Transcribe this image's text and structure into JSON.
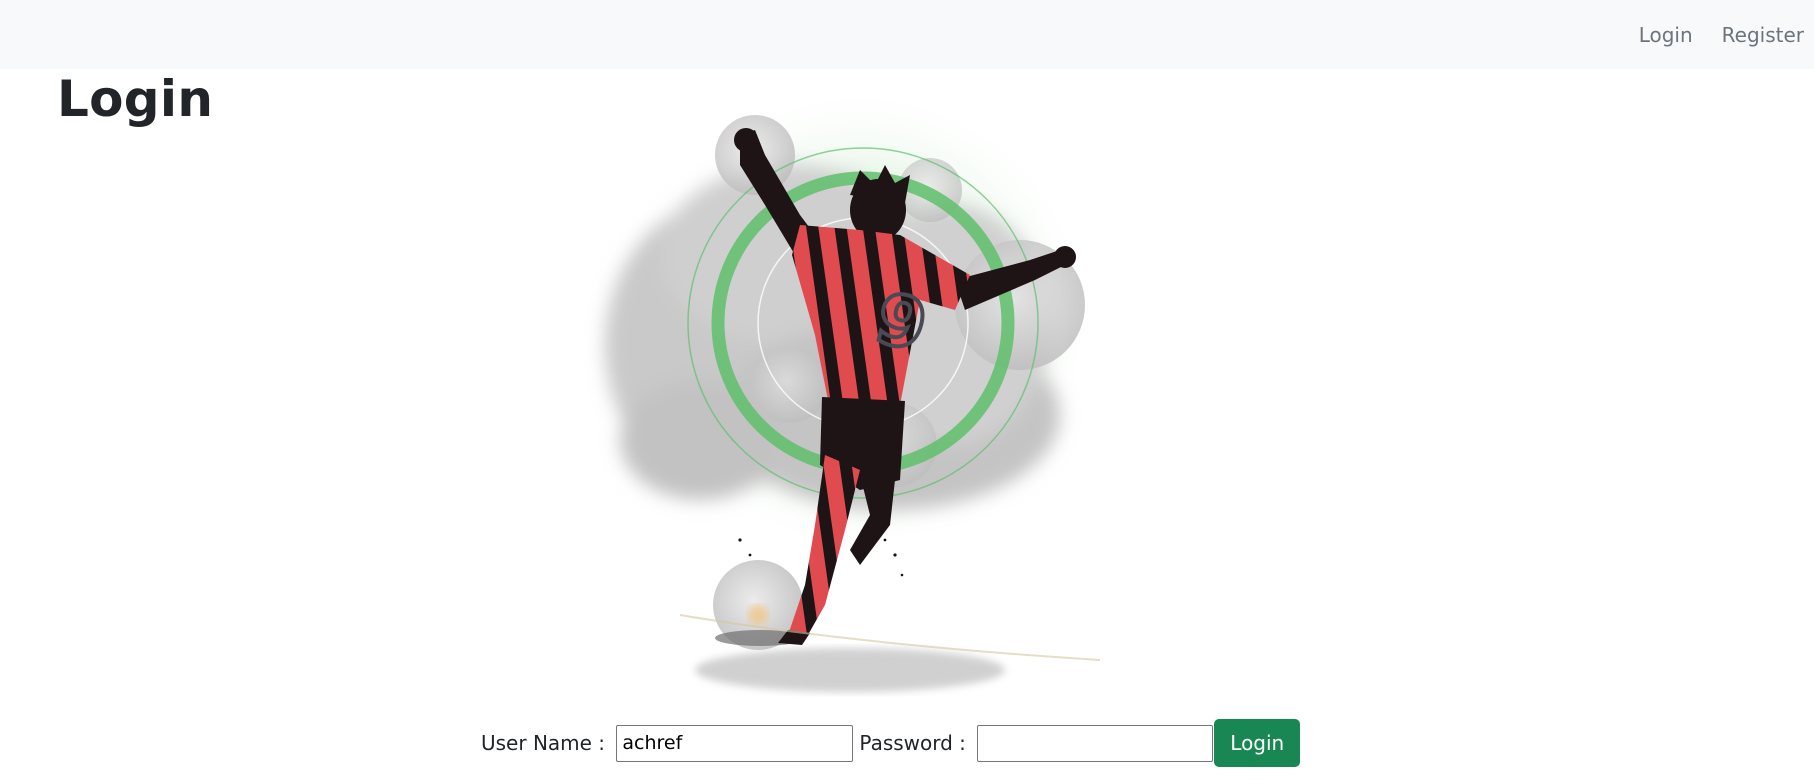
{
  "navbar": {
    "links": [
      {
        "label": "Login"
      },
      {
        "label": "Register"
      }
    ]
  },
  "page": {
    "title": "Login"
  },
  "hero": {
    "jersey_number": "9",
    "colors": {
      "jersey_red": "#e04b4f",
      "jersey_black": "#1e1416",
      "ring_green": "#5fbf6c",
      "smoke_grey": "#c9c9c9"
    }
  },
  "form": {
    "username_label": "User Name : ",
    "username_value": "achref",
    "password_label": "Password : ",
    "password_value": "",
    "submit_label": "Login"
  },
  "theme": {
    "navbar_bg": "#f8f9fa",
    "button_green": "#198754"
  }
}
